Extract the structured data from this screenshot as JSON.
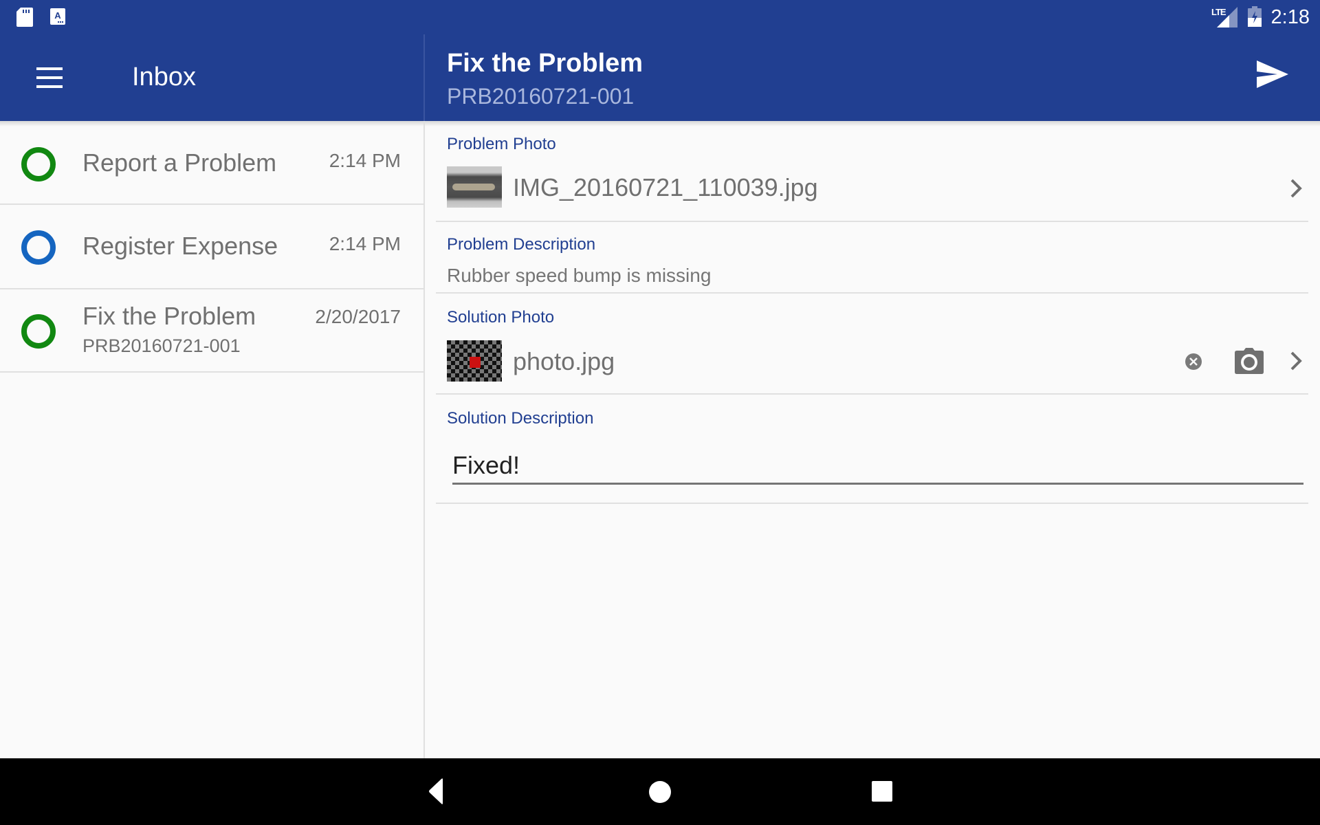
{
  "status_bar": {
    "left_icons": [
      "sd-card-icon",
      "keyboard-icon"
    ],
    "network_label": "LTE",
    "right_icons": [
      "lte-signal-icon",
      "battery-charging-icon"
    ],
    "time": "2:18"
  },
  "inbox_header": {
    "menu_icon": "hamburger-menu-icon",
    "title": "Inbox"
  },
  "detail_header": {
    "title": "Fix the Problem",
    "subtitle": "PRB20160721-001",
    "send_icon": "send-icon"
  },
  "inbox": {
    "items": [
      {
        "label": "Report a Problem",
        "subtitle": "",
        "time": "2:14 PM",
        "status_color": "#118811"
      },
      {
        "label": "Register Expense",
        "subtitle": "",
        "time": "2:14 PM",
        "status_color": "#1565c0"
      },
      {
        "label": "Fix the Problem",
        "subtitle": "PRB20160721-001",
        "time": "2/20/2017",
        "status_color": "#118811"
      }
    ]
  },
  "form": {
    "problem_photo": {
      "label": "Problem Photo",
      "file_name": "IMG_20160721_110039.jpg"
    },
    "problem_description": {
      "label": "Problem Description",
      "value": "Rubber speed bump is missing"
    },
    "solution_photo": {
      "label": "Solution Photo",
      "file_name": "photo.jpg",
      "actions": [
        "clear-icon",
        "camera-icon",
        "chevron-right-icon"
      ]
    },
    "solution_description": {
      "label": "Solution Description",
      "value": "Fixed!"
    }
  },
  "nav_bar": {
    "buttons": [
      "back",
      "home",
      "recents"
    ]
  },
  "colors": {
    "primary": "#213f91",
    "accent_label": "#213f91",
    "status_green": "#118811",
    "status_blue": "#1565c0"
  }
}
